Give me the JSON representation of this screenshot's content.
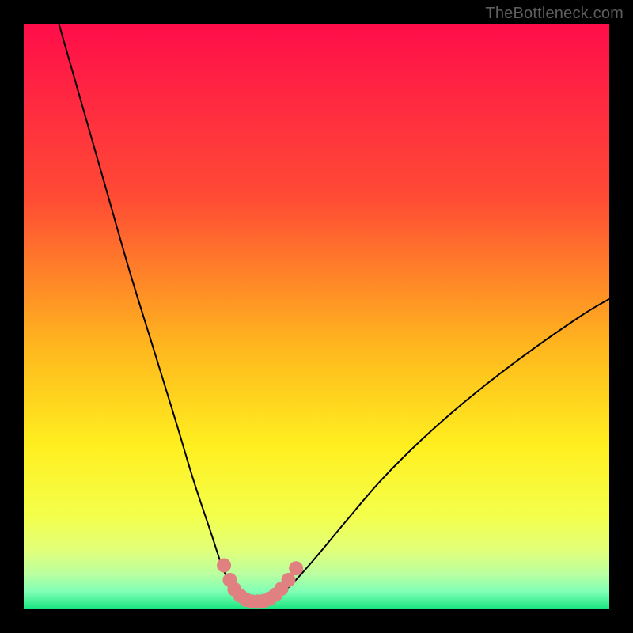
{
  "watermark": "TheBottleneck.com",
  "chart_data": {
    "type": "line",
    "title": "",
    "xlabel": "",
    "ylabel": "",
    "xlim": [
      0,
      100
    ],
    "ylim": [
      0,
      100
    ],
    "grid": false,
    "legend": false,
    "background_gradient": {
      "stops": [
        {
          "pos": 0.0,
          "color": "#ff0d4a"
        },
        {
          "pos": 0.3,
          "color": "#ff4c34"
        },
        {
          "pos": 0.55,
          "color": "#ffb61e"
        },
        {
          "pos": 0.72,
          "color": "#ffef1f"
        },
        {
          "pos": 0.84,
          "color": "#f4ff4b"
        },
        {
          "pos": 0.9,
          "color": "#e1ff7a"
        },
        {
          "pos": 0.94,
          "color": "#baffa0"
        },
        {
          "pos": 0.97,
          "color": "#7fffb6"
        },
        {
          "pos": 1.0,
          "color": "#17e57e"
        }
      ]
    },
    "series": [
      {
        "name": "bottleneck-curve",
        "x": [
          6,
          10,
          14,
          18,
          22,
          26,
          29,
          32,
          34,
          36,
          37.5,
          39,
          41,
          43,
          46,
          50,
          55,
          61,
          68,
          76,
          85,
          95,
          100
        ],
        "values": [
          100,
          86,
          72,
          58,
          45,
          32,
          22,
          13,
          7,
          3,
          1.5,
          1.2,
          1.3,
          2,
          4.5,
          9,
          15,
          22,
          29,
          36,
          43,
          50,
          53
        ],
        "color": "#000000"
      }
    ],
    "markers": {
      "name": "minimum-region-dots",
      "color": "#e08080",
      "points": [
        {
          "x": 34.2,
          "y": 7.5
        },
        {
          "x": 35.2,
          "y": 5.0
        },
        {
          "x": 36.0,
          "y": 3.4
        },
        {
          "x": 37.0,
          "y": 2.3
        },
        {
          "x": 38.0,
          "y": 1.6
        },
        {
          "x": 39.0,
          "y": 1.3
        },
        {
          "x": 40.0,
          "y": 1.3
        },
        {
          "x": 41.0,
          "y": 1.4
        },
        {
          "x": 42.0,
          "y": 1.8
        },
        {
          "x": 43.0,
          "y": 2.5
        },
        {
          "x": 44.0,
          "y": 3.5
        },
        {
          "x": 45.2,
          "y": 5.0
        },
        {
          "x": 46.5,
          "y": 7.0
        }
      ]
    }
  }
}
